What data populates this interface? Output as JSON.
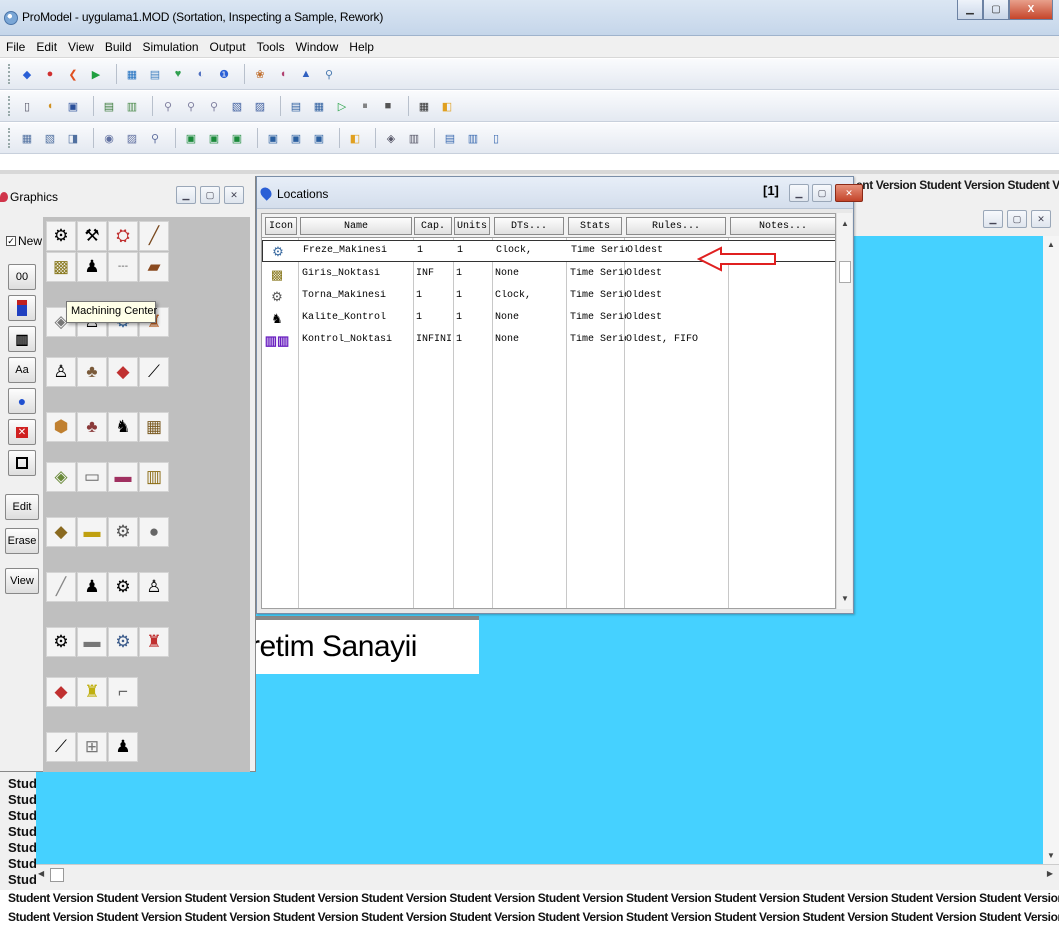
{
  "window": {
    "title": "ProModel - uygulama1.MOD (Sortation, Inspecting a Sample, Rework)"
  },
  "menubar": [
    {
      "label": "File"
    },
    {
      "label": "Edit"
    },
    {
      "label": "View"
    },
    {
      "label": "Build"
    },
    {
      "label": "Simulation"
    },
    {
      "label": "Output"
    },
    {
      "label": "Tools"
    },
    {
      "label": "Window"
    },
    {
      "label": "Help"
    }
  ],
  "graphics": {
    "title": "Graphics",
    "new_label": "New",
    "side_buttons": [
      {
        "label": "00"
      },
      {
        "label": ""
      },
      {
        "label": ""
      },
      {
        "label": "Aa"
      },
      {
        "label": ""
      },
      {
        "label": ""
      },
      {
        "label": ""
      }
    ],
    "edit_label": "Edit",
    "erase_label": "Erase",
    "view_label": "View",
    "tooltip": "Machining Center"
  },
  "locations": {
    "title": "Locations",
    "index_label": "[1]",
    "columns": [
      "Icon",
      "Name",
      "Cap.",
      "Units",
      "DTs...",
      "Stats",
      "Rules...",
      "Notes..."
    ],
    "rows": [
      {
        "name": "Freze_Makinesi",
        "cap": "1",
        "units": "1",
        "dts": "Clock,",
        "stats": "Time Serie",
        "rules": "Oldest",
        "notes": ""
      },
      {
        "name": "Giris_Noktasi",
        "cap": "INF",
        "units": "1",
        "dts": "None",
        "stats": "Time Serie",
        "rules": "Oldest",
        "notes": ""
      },
      {
        "name": "Torna_Makinesi",
        "cap": "1",
        "units": "1",
        "dts": "Clock,",
        "stats": "Time Serie",
        "rules": "Oldest",
        "notes": ""
      },
      {
        "name": "Kalite_Kontrol",
        "cap": "1",
        "units": "1",
        "dts": "None",
        "stats": "Time Serie",
        "rules": "Oldest",
        "notes": ""
      },
      {
        "name": "Kontrol_Noktasi",
        "cap": "INFINIT",
        "units": "1",
        "dts": "None",
        "stats": "Time Serie",
        "rules": "Oldest, FIFO",
        "notes": ""
      }
    ]
  },
  "layout": {
    "banner_text": "retim Sanayii",
    "student_watermark": "Student Version Student Version Student Version Student Version Student Version Student Version Student Version Student Version Student Version Student Version Student Version Student Version Student Version Student Vers",
    "student_header": "ent Version Student Version Student Vers",
    "student_side": "Stud"
  },
  "colors": {
    "canvas": "#45d1ff",
    "annotation_arrow": "#e02020"
  }
}
